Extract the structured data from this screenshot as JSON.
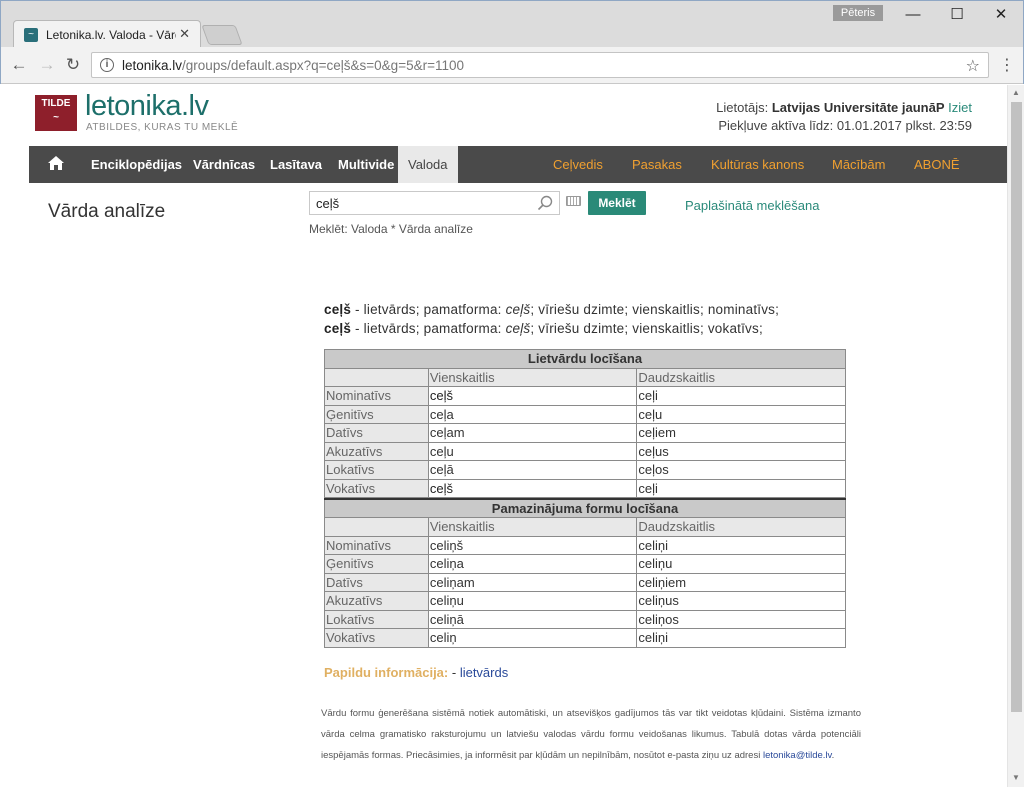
{
  "browser": {
    "tab_title": "Letonika.lv. Valoda - Vārd",
    "tab_close": "✕",
    "user_badge": "Pēteris",
    "url_host": "letonika.lv",
    "url_path": "/groups/default.aspx?q=ceļš&s=0&g=5&r=1100"
  },
  "site": {
    "logo_box": "TILDE",
    "logo_name": "letonika.lv",
    "tagline": "ATBILDES, KURAS TU MEKLĒ",
    "user_label": "Lietotājs:",
    "user_name": "Latvijas Universitāte jaunāP",
    "logout": "Iziet",
    "access_until": "Piekļuve aktīva līdz: 01.01.2017 plkst. 23:59"
  },
  "nav": {
    "items": [
      {
        "label": "Enciklopēdijas"
      },
      {
        "label": "Vārdnīcas"
      },
      {
        "label": "Lasītava"
      },
      {
        "label": "Multivide"
      },
      {
        "label": "Valoda"
      }
    ],
    "right_items": [
      {
        "label": "Ceļvedis"
      },
      {
        "label": "Pasakas"
      },
      {
        "label": "Kultūras kanons"
      },
      {
        "label": "Mācībām"
      },
      {
        "label": "ABONĒ"
      }
    ]
  },
  "main": {
    "section_title": "Vārda analīze",
    "search_value": "ceļš",
    "search_button": "Meklēt",
    "advanced_search": "Paplašinātā meklēšana",
    "breadcrumb": "Meklēt: Valoda * Vārda analīze"
  },
  "analysis": [
    {
      "word": "ceļš",
      "pre": " - lietvārds; pamatforma: ",
      "base": "ceļš",
      "post": "; vīriešu dzimte; vienskaitlis; nominatīvs;"
    },
    {
      "word": "ceļš",
      "pre": " - lietvārds; pamatforma: ",
      "base": "ceļš",
      "post": "; vīriešu dzimte; vienskaitlis; vokatīvs;"
    }
  ],
  "table1": {
    "caption": "Lietvārdu locīšana",
    "headers": [
      "",
      "Vienskaitlis",
      "Daudzskaitlis"
    ],
    "rows": [
      [
        "Nominatīvs",
        "ceļš",
        "ceļi"
      ],
      [
        "Ģenitīvs",
        "ceļa",
        "ceļu"
      ],
      [
        "Datīvs",
        "ceļam",
        "ceļiem"
      ],
      [
        "Akuzatīvs",
        "ceļu",
        "ceļus"
      ],
      [
        "Lokatīvs",
        "ceļā",
        "ceļos"
      ],
      [
        "Vokatīvs",
        "ceļš",
        "ceļi"
      ]
    ]
  },
  "table2": {
    "caption": "Pamazinājuma formu locīšana",
    "headers": [
      "",
      "Vienskaitlis",
      "Daudzskaitlis"
    ],
    "rows": [
      [
        "Nominatīvs",
        "celiņš",
        "celiņi"
      ],
      [
        "Ģenitīvs",
        "celiņa",
        "celiņu"
      ],
      [
        "Datīvs",
        "celiņam",
        "celiņiem"
      ],
      [
        "Akuzatīvs",
        "celiņu",
        "celiņus"
      ],
      [
        "Lokatīvs",
        "celiņā",
        "celiņos"
      ],
      [
        "Vokatīvs",
        "celiņ",
        "celiņi"
      ]
    ]
  },
  "extra": {
    "label": "Papildu informācija:",
    "sep": " - ",
    "link": "lietvārds"
  },
  "note": {
    "text": "Vārdu formu ģenerēšana sistēmā notiek automātiski, un atsevišķos gadījumos tās var tikt veidotas kļūdaini. Sistēma izmanto vārda celma gramatisko raksturojumu un latviešu valodas vārdu formu veidošanas likumus. Tabulā dotas vārda potenciāli iespējamās formas. Priecāsimies, ja informēsit par kļūdām un nepilnībām, nosūtot e-pasta ziņu uz adresi ",
    "email": "letonika@tilde.lv",
    "end": "."
  }
}
